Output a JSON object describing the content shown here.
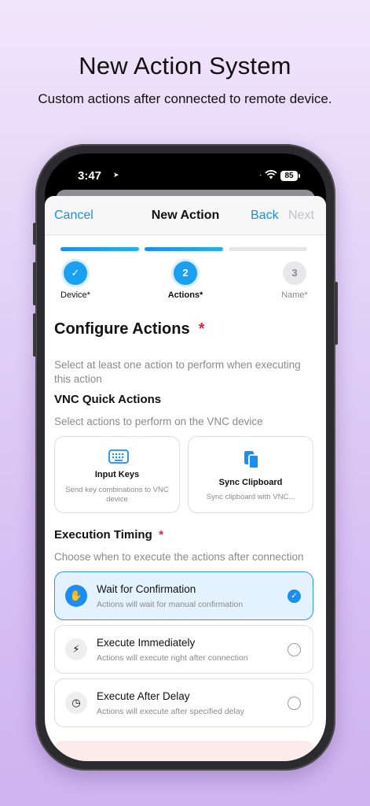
{
  "hero": {
    "title": "New Action System",
    "subtitle": "Custom actions after connected to remote device."
  },
  "status_bar": {
    "time": "3:47",
    "battery": "85"
  },
  "navbar": {
    "cancel": "Cancel",
    "title": "New Action",
    "back": "Back",
    "next": "Next"
  },
  "steps": [
    {
      "label": "Device*",
      "number": "",
      "state": "done"
    },
    {
      "label": "Actions*",
      "number": "2",
      "state": "current"
    },
    {
      "label": "Name*",
      "number": "3",
      "state": "pending"
    }
  ],
  "configure": {
    "title": "Configure Actions",
    "required_mark": "*",
    "description": "Select at least one action to perform when executing this action"
  },
  "vnc": {
    "title": "VNC Quick Actions",
    "description": "Select actions to perform on the VNC device",
    "cards": [
      {
        "title": "Input Keys",
        "subtitle": "Send key combinations to VNC device",
        "icon": "keyboard-icon"
      },
      {
        "title": "Sync Clipboard",
        "subtitle": "Sync clipboard with VNC...",
        "icon": "clipboard-icon"
      }
    ]
  },
  "timing": {
    "title": "Execution Timing",
    "required_mark": "*",
    "description": "Choose when to execute the actions after connection",
    "options": [
      {
        "title": "Wait for Confirmation",
        "subtitle": "Actions will wait for manual confirmation",
        "icon": "hand-icon",
        "selected": true
      },
      {
        "title": "Execute Immediately",
        "subtitle": "Actions will execute right after connection",
        "icon": "bolt-icon",
        "selected": false
      },
      {
        "title": "Execute After Delay",
        "subtitle": "Actions will execute after specified delay",
        "icon": "clock-icon",
        "selected": false
      }
    ]
  },
  "colors": {
    "accent": "#1a8ef2",
    "required": "#e3263b",
    "selected_bg": "#e4f2fe"
  }
}
